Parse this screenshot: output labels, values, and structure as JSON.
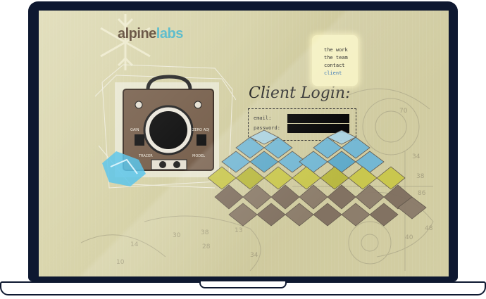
{
  "brand": {
    "logo_part1": "alpine",
    "logo_part2": "labs",
    "colors": {
      "dark": "#5b4633",
      "accent": "#4fb7c8"
    }
  },
  "nav": {
    "items": [
      {
        "label": "the work",
        "active": false
      },
      {
        "label": "the team",
        "active": false
      },
      {
        "label": "contact",
        "active": false
      },
      {
        "label": "client",
        "active": true
      }
    ]
  },
  "login": {
    "title": "Client Login:",
    "email_label": "email:",
    "password_label": "password:",
    "email_value": "",
    "password_value": ""
  },
  "device": {
    "label_left": "GAIN",
    "label_right": "ZERO ADJ",
    "label_bottom_left": "TRACER",
    "label_bottom_right": "MODEL"
  },
  "sketch_numbers": [
    "70",
    "34",
    "38",
    "86",
    "48",
    "30",
    "38",
    "28",
    "14",
    "13",
    "40",
    "34",
    "10"
  ],
  "pattern_colors": [
    "#6fb6d6",
    "#c9c74a",
    "#7e6e5f"
  ]
}
